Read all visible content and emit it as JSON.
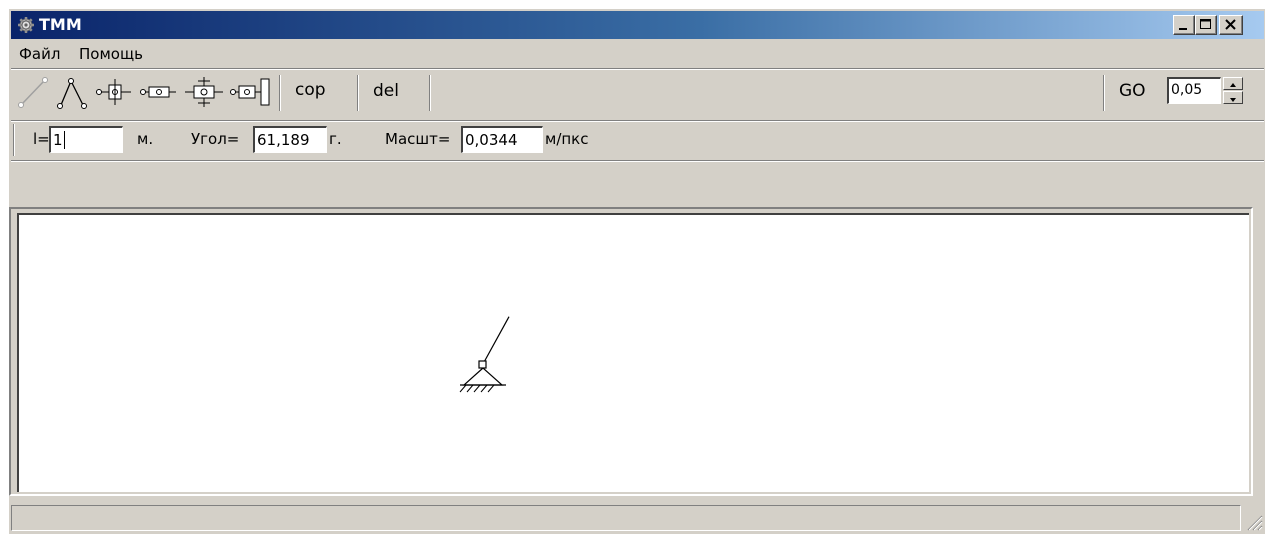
{
  "window": {
    "title": "TMM"
  },
  "menu": {
    "items": [
      "Файл",
      "Помощь"
    ]
  },
  "toolbar": {
    "tools": [
      "link-tool",
      "dyad-tool",
      "slider-tool",
      "slider-block-tool",
      "rotary-slider-tool",
      "guide-slider-tool"
    ],
    "cop_label": "cop",
    "del_label": "del",
    "go_label": "GO",
    "go_value": "0,05"
  },
  "params": {
    "length_label": "l=",
    "length_value": "1",
    "length_unit": "м.",
    "angle_label": "Угол=",
    "angle_value": "61,189",
    "angle_unit": "г.",
    "scale_label": "Масшт=",
    "scale_value": "0,0344",
    "scale_unit": "м/пкс"
  },
  "canvas": {
    "mechanism": {
      "link_angle_deg": 61.189
    }
  },
  "status": {
    "text": ""
  },
  "colors": {
    "titlebar_start": "#0a246a",
    "titlebar_end": "#a6caf0",
    "face": "#d4d0c8"
  }
}
